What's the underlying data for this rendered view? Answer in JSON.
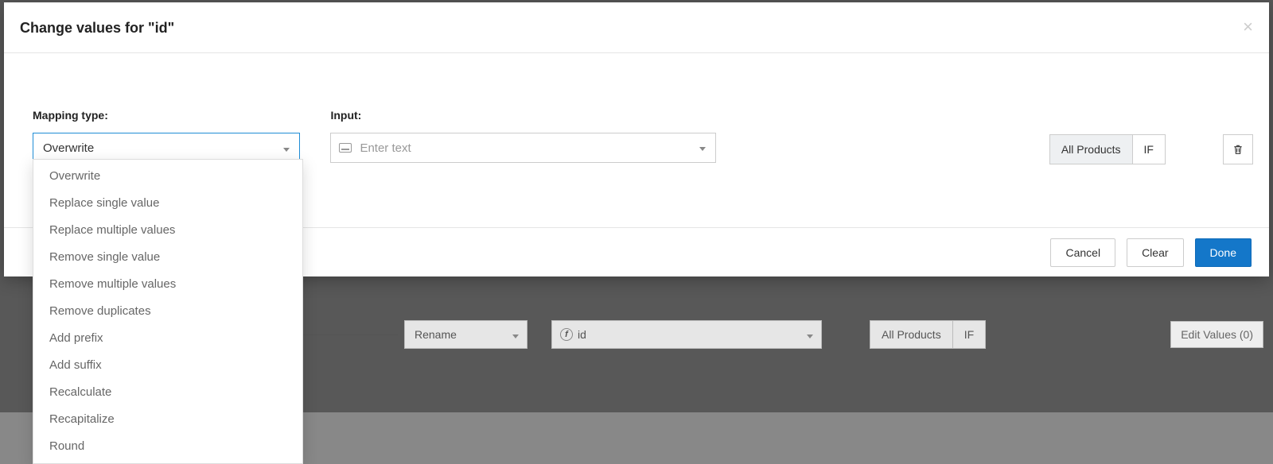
{
  "modal": {
    "title": "Change values for \"id\"",
    "mapping_label": "Mapping type:",
    "mapping_selected": "Overwrite",
    "mapping_options": [
      "Overwrite",
      "Replace single value",
      "Replace multiple values",
      "Remove single value",
      "Remove multiple values",
      "Remove duplicates",
      "Add prefix",
      "Add suffix",
      "Recalculate",
      "Recapitalize",
      "Round"
    ],
    "input_label": "Input:",
    "input_placeholder": "Enter text",
    "scope_all": "All Products",
    "scope_if": "IF",
    "footer": {
      "cancel": "Cancel",
      "clear": "Clear",
      "done": "Done"
    }
  },
  "background_row": {
    "action": "Rename",
    "field": "id",
    "scope_all": "All Products",
    "scope_if": "IF",
    "edit_values": "Edit Values (0)"
  }
}
